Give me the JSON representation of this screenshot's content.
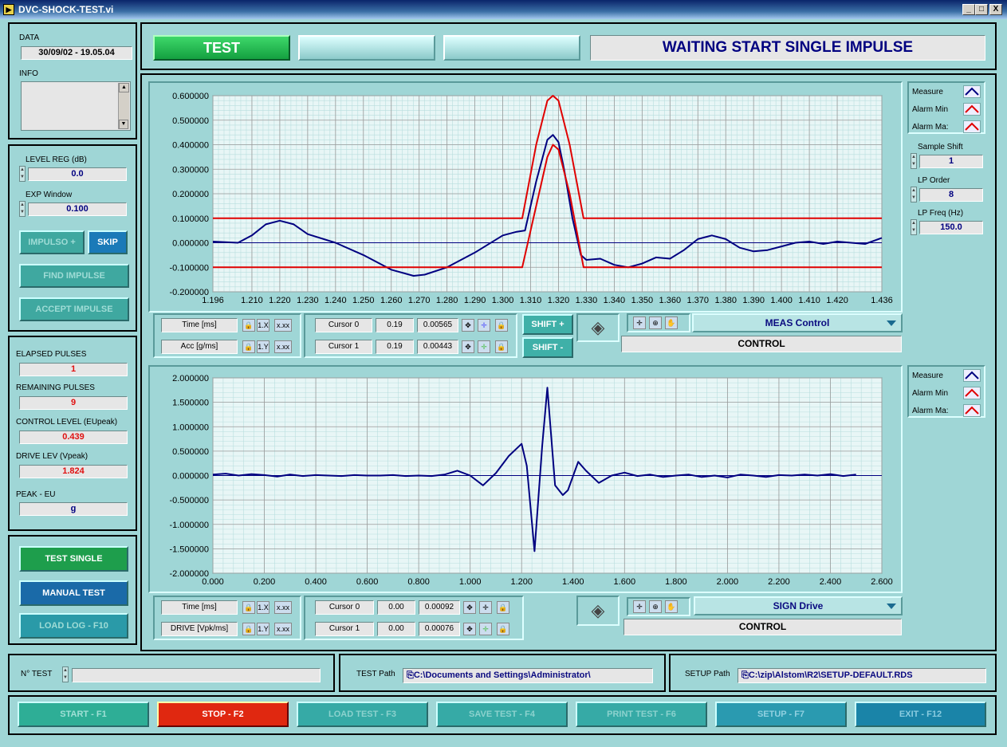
{
  "window": {
    "title": "DVC-SHOCK-TEST.vi",
    "min": "_",
    "max": "□",
    "close": "X"
  },
  "header": {
    "test_label": "TEST",
    "status": "WAITING START SINGLE IMPULSE"
  },
  "info_panel": {
    "data_label": "DATA",
    "data_value": "30/09/02 - 19.05.04",
    "info_label": "INFO"
  },
  "level_panel": {
    "level_reg_label": "LEVEL REG (dB)",
    "level_reg_value": "0.0",
    "exp_window_label": "EXP Window",
    "exp_window_value": "0.100",
    "impulso_btn": "IMPULSO +",
    "skip_btn": "SKIP",
    "find_impulse_btn": "FIND IMPULSE",
    "accept_impulse_btn": "ACCEPT IMPULSE"
  },
  "stats": {
    "elapsed_label": "ELAPSED PULSES",
    "elapsed_value": "1",
    "remaining_label": "REMAINING PULSES",
    "remaining_value": "9",
    "control_level_label": "CONTROL LEVEL (EUpeak)",
    "control_level_value": "0.439",
    "drive_lev_label": "DRIVE LEV (Vpeak)",
    "drive_lev_value": "1.824",
    "peak_label": "PEAK - EU",
    "peak_value": "g"
  },
  "test_buttons": {
    "test_single": "TEST SINGLE",
    "manual_test": "MANUAL TEST",
    "load_log": "LOAD LOG - F10"
  },
  "top_graph_ctrl": {
    "x_name": "Time [ms]",
    "y_name": "Acc [g/ms]",
    "x_scale": "1.X",
    "y_scale": "1.Y",
    "fmt": "x.xx",
    "cursor0_label": "Cursor 0",
    "cursor0_x": "0.19",
    "cursor0_y": "0.00565",
    "cursor1_label": "Cursor 1",
    "cursor1_x": "0.19",
    "cursor1_y": "0.00443",
    "shift_plus": "SHIFT +",
    "shift_minus": "SHIFT -",
    "select": "MEAS Control",
    "control_label": "CONTROL"
  },
  "bottom_graph_ctrl": {
    "x_name": "Time [ms]",
    "y_name": "DRIVE [Vpk/ms]",
    "x_scale": "1.X",
    "y_scale": "1.Y",
    "fmt": "x.xx",
    "cursor0_label": "Cursor 0",
    "cursor0_x": "0.00",
    "cursor0_y": "0.00092",
    "cursor1_label": "Cursor 1",
    "cursor1_x": "0.00",
    "cursor1_y": "0.00076",
    "select": "SIGN Drive",
    "control_label": "CONTROL"
  },
  "legend_top": [
    "Measure",
    "Alarm Min",
    "Alarm Ma:"
  ],
  "legend_bottom": [
    "Measure",
    "Alarm Min",
    "Alarm Ma:"
  ],
  "params": {
    "sample_shift_label": "Sample Shift",
    "sample_shift_value": "1",
    "lp_order_label": "LP Order",
    "lp_order_value": "8",
    "lp_freq_label": "LP Freq (Hz)",
    "lp_freq_value": "150.0"
  },
  "footer": {
    "ntest_label": "N° TEST",
    "test_path_label": "TEST Path",
    "test_path_value": "C:\\Documents and Settings\\Administrator\\",
    "setup_path_label": "SETUP Path",
    "setup_path_value": "C:\\zip\\Alstom\\R2\\SETUP-DEFAULT.RDS"
  },
  "fkeys": {
    "start": "START - F1",
    "stop": "STOP - F2",
    "load_test": "LOAD TEST - F3",
    "save_test": "SAVE TEST - F4",
    "print_test": "PRINT TEST - F6",
    "setup": "SETUP - F7",
    "exit": "EXIT - F12"
  },
  "colors": {
    "measure": "#000080",
    "alarm": "#e00000",
    "grid_major": "#9a9a9a",
    "grid_minor": "#b8dede"
  },
  "chart_data": [
    {
      "type": "line",
      "title": "",
      "xlabel": "",
      "ylabel": "",
      "xlim": [
        1.196,
        1.436
      ],
      "ylim": [
        -0.2,
        0.6
      ],
      "x_ticks": [
        "1.196",
        "1.210",
        "1.220",
        "1.230",
        "1.240",
        "1.250",
        "1.260",
        "1.270",
        "1.280",
        "1.290",
        "1.300",
        "1.310",
        "1.320",
        "1.330",
        "1.340",
        "1.350",
        "1.360",
        "1.370",
        "1.380",
        "1.390",
        "1.400",
        "1.410",
        "1.420",
        "1.436"
      ],
      "x_tick_values": [
        1.196,
        1.21,
        1.22,
        1.23,
        1.24,
        1.25,
        1.26,
        1.27,
        1.28,
        1.29,
        1.3,
        1.31,
        1.32,
        1.33,
        1.34,
        1.35,
        1.36,
        1.37,
        1.38,
        1.39,
        1.4,
        1.41,
        1.42,
        1.436
      ],
      "y_ticks": [
        "-0.200000",
        "-0.100000",
        "0.000000",
        "0.100000",
        "0.200000",
        "0.300000",
        "0.400000",
        "0.500000",
        "0.600000"
      ],
      "y_tick_values": [
        -0.2,
        -0.1,
        0,
        0.1,
        0.2,
        0.3,
        0.4,
        0.5,
        0.6
      ],
      "series": [
        {
          "name": "Measure",
          "color": "#000080",
          "x": [
            1.196,
            1.205,
            1.21,
            1.215,
            1.22,
            1.225,
            1.23,
            1.24,
            1.25,
            1.26,
            1.268,
            1.272,
            1.28,
            1.29,
            1.3,
            1.305,
            1.308,
            1.312,
            1.316,
            1.318,
            1.32,
            1.322,
            1.325,
            1.328,
            1.33,
            1.335,
            1.34,
            1.345,
            1.35,
            1.355,
            1.36,
            1.365,
            1.37,
            1.375,
            1.38,
            1.385,
            1.39,
            1.395,
            1.4,
            1.405,
            1.41,
            1.415,
            1.42,
            1.425,
            1.43,
            1.436
          ],
          "y": [
            0.005,
            0.0,
            0.03,
            0.075,
            0.09,
            0.075,
            0.035,
            0.0,
            -0.05,
            -0.11,
            -0.135,
            -0.13,
            -0.1,
            -0.04,
            0.03,
            0.045,
            0.05,
            0.25,
            0.42,
            0.44,
            0.41,
            0.3,
            0.1,
            -0.05,
            -0.07,
            -0.065,
            -0.09,
            -0.1,
            -0.085,
            -0.06,
            -0.065,
            -0.03,
            0.015,
            0.03,
            0.015,
            -0.02,
            -0.035,
            -0.03,
            -0.015,
            0.0,
            0.005,
            -0.005,
            0.005,
            0.0,
            -0.005,
            0.02
          ]
        },
        {
          "name": "Alarm Min",
          "color": "#e00000",
          "x": [
            1.196,
            1.307,
            1.312,
            1.316,
            1.318,
            1.32,
            1.324,
            1.329,
            1.436
          ],
          "y": [
            -0.1,
            -0.1,
            0.15,
            0.35,
            0.4,
            0.38,
            0.2,
            -0.1,
            -0.1
          ]
        },
        {
          "name": "Alarm Max",
          "color": "#e00000",
          "x": [
            1.196,
            1.307,
            1.312,
            1.316,
            1.318,
            1.32,
            1.324,
            1.329,
            1.436
          ],
          "y": [
            0.1,
            0.1,
            0.4,
            0.58,
            0.6,
            0.58,
            0.4,
            0.1,
            0.1
          ]
        }
      ]
    },
    {
      "type": "line",
      "title": "",
      "xlabel": "",
      "ylabel": "",
      "xlim": [
        0.0,
        2.6
      ],
      "ylim": [
        -2.0,
        2.0
      ],
      "x_ticks": [
        "0.000",
        "0.200",
        "0.400",
        "0.600",
        "0.800",
        "1.000",
        "1.200",
        "1.400",
        "1.600",
        "1.800",
        "2.000",
        "2.200",
        "2.400",
        "2.600"
      ],
      "x_tick_values": [
        0,
        0.2,
        0.4,
        0.6,
        0.8,
        1.0,
        1.2,
        1.4,
        1.6,
        1.8,
        2.0,
        2.2,
        2.4,
        2.6
      ],
      "y_ticks": [
        "-2.000000",
        "-1.500000",
        "-1.000000",
        "-0.500000",
        "0.000000",
        "0.500000",
        "1.000000",
        "1.500000",
        "2.000000"
      ],
      "y_tick_values": [
        -2,
        -1.5,
        -1,
        -0.5,
        0,
        0.5,
        1,
        1.5,
        2
      ],
      "series": [
        {
          "name": "Measure",
          "color": "#000080",
          "x": [
            0.0,
            0.05,
            0.1,
            0.15,
            0.2,
            0.25,
            0.3,
            0.35,
            0.4,
            0.45,
            0.5,
            0.55,
            0.6,
            0.65,
            0.7,
            0.75,
            0.8,
            0.85,
            0.9,
            0.95,
            1.0,
            1.05,
            1.1,
            1.15,
            1.2,
            1.22,
            1.25,
            1.28,
            1.3,
            1.33,
            1.36,
            1.38,
            1.42,
            1.45,
            1.5,
            1.55,
            1.6,
            1.65,
            1.7,
            1.75,
            1.8,
            1.85,
            1.9,
            1.95,
            2.0,
            2.05,
            2.1,
            2.15,
            2.2,
            2.25,
            2.3,
            2.35,
            2.4,
            2.45,
            2.5
          ],
          "y": [
            0.02,
            0.04,
            0.0,
            0.03,
            0.01,
            -0.02,
            0.02,
            -0.01,
            0.01,
            0.0,
            -0.01,
            0.01,
            0.0,
            0.0,
            0.01,
            -0.01,
            0.0,
            -0.01,
            0.02,
            0.1,
            0.0,
            -0.2,
            0.05,
            0.4,
            0.65,
            0.2,
            -1.55,
            0.6,
            1.8,
            -0.2,
            -0.4,
            -0.3,
            0.28,
            0.1,
            -0.15,
            0.0,
            0.06,
            -0.01,
            0.02,
            -0.03,
            0.0,
            0.02,
            -0.03,
            0.0,
            -0.04,
            0.02,
            0.0,
            -0.03,
            0.01,
            0.0,
            0.02,
            0.0,
            0.03,
            -0.01,
            0.02
          ]
        }
      ]
    }
  ]
}
